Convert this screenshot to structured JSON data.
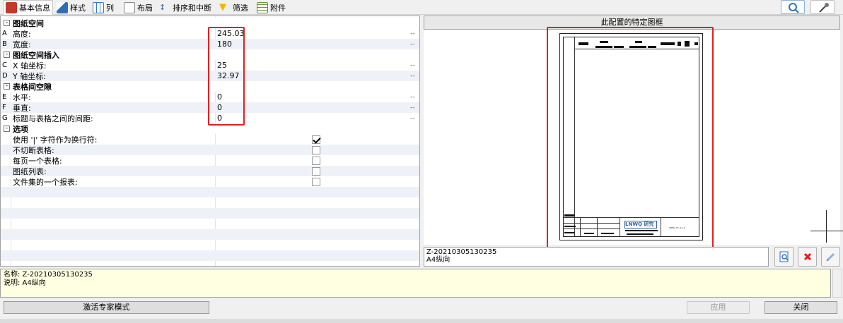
{
  "toolbar": {
    "tabs": [
      {
        "label": "基本信息",
        "icon": "app-logo-icon",
        "color": "#c0392b"
      },
      {
        "label": "样式",
        "icon": "style-icon",
        "color": "#2f6fb5"
      },
      {
        "label": "列",
        "icon": "columns-icon",
        "color": "#3a78c0"
      },
      {
        "label": "布局",
        "icon": "layout-icon",
        "color": "#8a8a8a"
      },
      {
        "label": "排序和中断",
        "icon": "sort-icon",
        "color": "#3366aa"
      },
      {
        "label": "筛选",
        "icon": "filter-icon",
        "color": "#f2b500"
      },
      {
        "label": "附件",
        "icon": "attachment-icon",
        "color": "#6b8f3a"
      }
    ],
    "right_icons": [
      "magnifier-icon",
      "pin-icon"
    ]
  },
  "grid": {
    "sections": [
      {
        "title": "图纸空间",
        "rows": [
          {
            "letter": "A",
            "name": "高度:",
            "value": "245.03",
            "dash": "--"
          },
          {
            "letter": "B",
            "name": "宽度:",
            "value": "180",
            "dash": "--"
          }
        ]
      },
      {
        "title": "图纸空间插入",
        "rows": [
          {
            "letter": "C",
            "name": "X 轴坐标:",
            "value": "25",
            "dash": "--"
          },
          {
            "letter": "D",
            "name": "Y 轴坐标:",
            "value": "32.97",
            "dash": "--"
          }
        ]
      },
      {
        "title": "表格间空隙",
        "rows": [
          {
            "letter": "E",
            "name": "水平:",
            "value": "0",
            "dash": "--"
          },
          {
            "letter": "F",
            "name": "垂直:",
            "value": "0",
            "dash": "--"
          },
          {
            "letter": "G",
            "name": "标题与表格之间的间距:",
            "value": "0",
            "dash": "--"
          }
        ]
      },
      {
        "title": "选项",
        "rows": [
          {
            "name": "使用 '|' 字符作为换行符:",
            "checked": true
          },
          {
            "name": "不切断表格:",
            "checked": false
          },
          {
            "name": "每页一个表格:",
            "checked": false
          },
          {
            "name": "图纸列表:",
            "checked": false
          },
          {
            "name": "文件集的一个报表:",
            "checked": false
          }
        ]
      }
    ]
  },
  "preview": {
    "header": "此配置的特定图框",
    "title_block_text": "LNWQ 研究",
    "small_code": "ABBD_T2_3_14",
    "info_line1": "Z-20210305130235",
    "info_line2": "A4纵向",
    "buttons": [
      "preview-icon",
      "delete-icon",
      "edit-icon"
    ]
  },
  "description": {
    "name_label": "名称: Z-20210305130235",
    "desc_label": "说明: A4纵向"
  },
  "footer": {
    "expert_mode": "激活专家模式",
    "apply": "应用",
    "close": "关闭"
  },
  "colors": {
    "highlight": "#e02020",
    "row_alt": "#eef2f8",
    "desc_bg": "#ffffe1"
  }
}
